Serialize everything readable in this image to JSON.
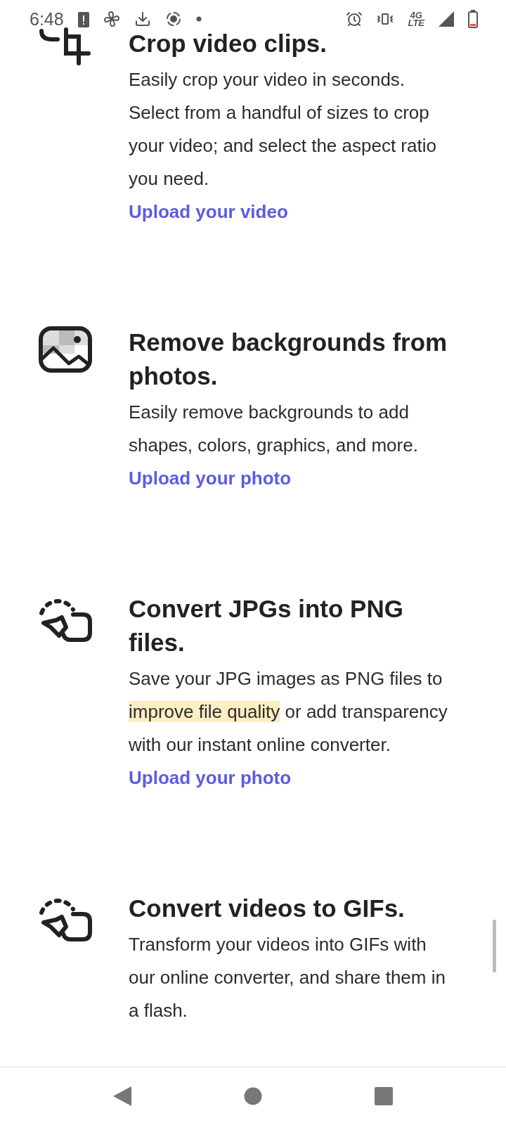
{
  "status_bar": {
    "time": "6:48",
    "network": "4G",
    "network_sub": "LTE"
  },
  "features": [
    {
      "kind": "crop",
      "title": "Crop video clips.",
      "body": [
        {
          "text": "Easily crop your video in seconds. Select from a handful of sizes to crop your video; and select the aspect ratio you need.",
          "highlighted": false
        }
      ],
      "link": "Upload your video"
    },
    {
      "kind": "image",
      "title": "Remove backgrounds from photos.",
      "body": [
        {
          "text": "Easily remove backgrounds to add shapes, colors, graphics, and more.",
          "highlighted": false
        }
      ],
      "link": "Upload your photo"
    },
    {
      "kind": "convert",
      "title": "Convert JPGs into PNG files.",
      "body": [
        {
          "text": "Save your JPG images as PNG files to ",
          "highlighted": false
        },
        {
          "text": "improve file quality",
          "highlighted": true
        },
        {
          "text": " or add transparency with our instant online converter.",
          "highlighted": false
        }
      ],
      "link": "Upload your photo"
    },
    {
      "kind": "convert",
      "title": "Convert videos to GIFs.",
      "body": [
        {
          "text": "Transform your videos into GIFs with our online converter, and share them in a flash.",
          "highlighted": false
        }
      ]
    }
  ]
}
